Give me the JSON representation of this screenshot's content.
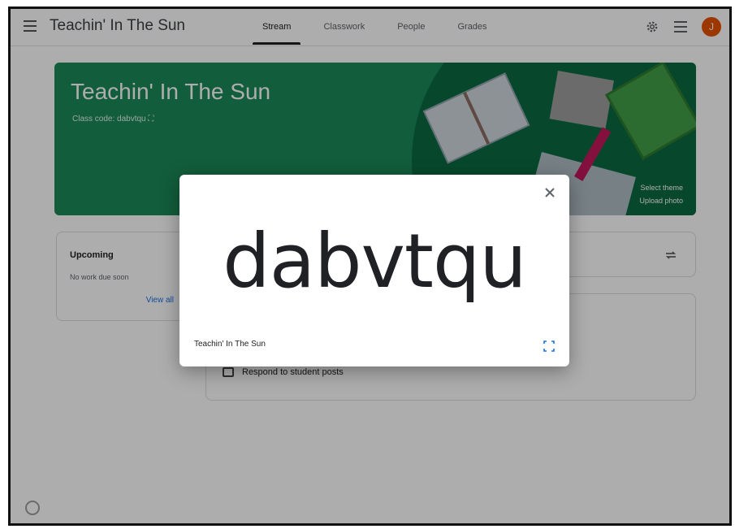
{
  "header": {
    "title": "Teachin' In The Sun",
    "tabs": [
      {
        "label": "Stream",
        "active": true
      },
      {
        "label": "Classwork",
        "active": false
      },
      {
        "label": "People",
        "active": false
      },
      {
        "label": "Grades",
        "active": false
      }
    ],
    "avatar_initial": "J"
  },
  "banner": {
    "class_name": "Teachin' In The Sun",
    "class_code_line": "Class code: dabvtqu",
    "select_theme": "Select theme",
    "upload_photo": "Upload photo"
  },
  "upcoming": {
    "heading": "Upcoming",
    "subtext": "No work due soon",
    "view_all": "View all"
  },
  "stream": {
    "respond_label": "Respond to student posts"
  },
  "modal": {
    "code": "dabvtqu",
    "class_name": "Teachin' In The Sun"
  },
  "colors": {
    "banner": "#1b8a57",
    "avatar": "#e65100",
    "accent": "#1a73e8"
  }
}
